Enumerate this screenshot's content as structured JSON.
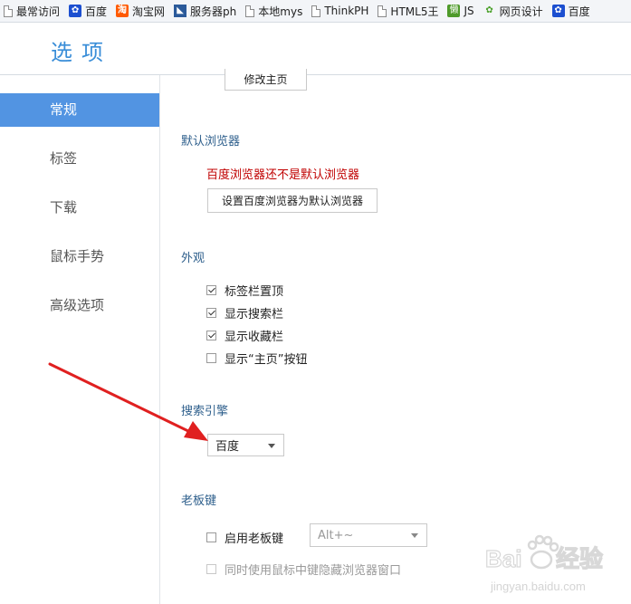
{
  "bookmarks": [
    {
      "label": "最常访问",
      "icon": "page-icon"
    },
    {
      "label": "百度",
      "icon": "baidu-paw-icon"
    },
    {
      "label": "淘宝网",
      "icon": "taobao-icon"
    },
    {
      "label": "服务器ph",
      "icon": "php-icon"
    },
    {
      "label": "本地mys",
      "icon": "page-icon"
    },
    {
      "label": "ThinkPH",
      "icon": "page-icon"
    },
    {
      "label": "HTML5王",
      "icon": "page-icon"
    },
    {
      "label": "JS",
      "icon": "lazy-icon"
    },
    {
      "label": "网页设计",
      "icon": "web-design-icon"
    },
    {
      "label": "百度",
      "icon": "baidu-paw-icon"
    }
  ],
  "title": "选项",
  "sidebar": {
    "items": [
      {
        "label": "常规",
        "active": true
      },
      {
        "label": "标签",
        "active": false
      },
      {
        "label": "下载",
        "active": false
      },
      {
        "label": "鼠标手势",
        "active": false
      },
      {
        "label": "高级选项",
        "active": false
      }
    ]
  },
  "content": {
    "homepage_button": "修改主页",
    "default_browser": {
      "title": "默认浏览器",
      "warning": "百度浏览器还不是默认浏览器",
      "button": "设置百度浏览器为默认浏览器"
    },
    "appearance": {
      "title": "外观",
      "options": [
        {
          "label": "标签栏置顶",
          "checked": true
        },
        {
          "label": "显示搜索栏",
          "checked": true
        },
        {
          "label": "显示收藏栏",
          "checked": true
        },
        {
          "label": "显示“主页”按钮",
          "checked": false
        }
      ]
    },
    "search_engine": {
      "title": "搜索引擎",
      "selected": "百度"
    },
    "boss_key": {
      "title": "老板键",
      "enable_label": "启用老板键",
      "enabled": false,
      "hotkey": "Alt+~",
      "middle_click_label": "同时使用鼠标中键隐藏浏览器窗口",
      "middle_click_checked": false
    }
  },
  "watermark": {
    "text": "Bai经验",
    "subtext": "jingyan.baidu.com"
  },
  "colors": {
    "accent": "#3a8ed8",
    "sidebar_active": "#5294e2",
    "warning": "#c00000",
    "annotation_arrow": "#e02020"
  }
}
